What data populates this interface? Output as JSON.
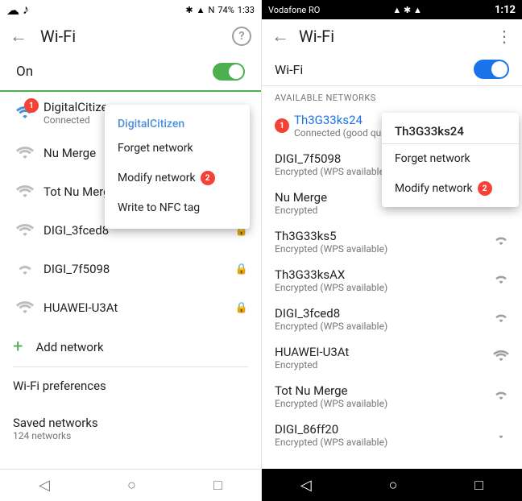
{
  "left": {
    "statusBar": {
      "leftIcons": "☁ 🎵",
      "bluetooth": "✦",
      "signal": "▲",
      "nfc": "N",
      "battery": "74%",
      "time": "1:33"
    },
    "toolbar": {
      "backLabel": "←",
      "title": "Wi-Fi",
      "helpLabel": "?"
    },
    "toggle": {
      "label": "On",
      "state": "on"
    },
    "networks": [
      {
        "name": "DigitalCitizen",
        "status": "Connected",
        "locked": false,
        "badge": "1",
        "connected": true
      },
      {
        "name": "Nu Merge",
        "status": "",
        "locked": true,
        "badge": "",
        "connected": false
      },
      {
        "name": "Tot Nu Merge",
        "status": "",
        "locked": true,
        "badge": "",
        "connected": false
      },
      {
        "name": "DIGI_3fced8",
        "status": "",
        "locked": true,
        "badge": "",
        "connected": false
      },
      {
        "name": "DIGI_7f5098",
        "status": "",
        "locked": true,
        "badge": "",
        "connected": false
      },
      {
        "name": "HUAWEI-U3At",
        "status": "",
        "locked": true,
        "badge": "",
        "connected": false
      }
    ],
    "addNetwork": "Add network",
    "wifiPreferences": "Wi-Fi preferences",
    "savedNetworks": {
      "label": "Saved networks",
      "sub": "124 networks"
    },
    "contextMenu": {
      "header": "DigitalCitizen",
      "items": [
        {
          "label": "Forget network",
          "badge": ""
        },
        {
          "label": "Modify network",
          "badge": "2"
        },
        {
          "label": "Write to NFC tag",
          "badge": ""
        }
      ]
    },
    "navBar": {
      "back": "◁",
      "home": "○",
      "recent": "□"
    }
  },
  "right": {
    "statusBar": {
      "carrier": "Vodafone RO",
      "icons": "▲▲✦▲",
      "battery": "■",
      "time": "1:12"
    },
    "toolbar": {
      "backLabel": "←",
      "title": "Wi-Fi",
      "moreLabel": "⋮"
    },
    "wifiToggle": {
      "label": "Wi-Fi"
    },
    "sectionHeader": "AVAILABLE NETWORKS",
    "networks": [
      {
        "name": "Th3G33ks24",
        "status": "Connected (good quality)",
        "highlight": true,
        "badge": "1"
      },
      {
        "name": "DIGI_7f5098",
        "status": "Encrypted (WPS available)",
        "highlight": false,
        "badge": ""
      },
      {
        "name": "Nu Merge",
        "status": "Encrypted",
        "highlight": false,
        "badge": ""
      },
      {
        "name": "Th3G33ks5",
        "status": "Encrypted (WPS available)",
        "highlight": false,
        "badge": ""
      },
      {
        "name": "Th3G33ksAX",
        "status": "Encrypted (WPS available)",
        "highlight": false,
        "badge": ""
      },
      {
        "name": "DIGI_3fced8",
        "status": "Encrypted (WPS available)",
        "highlight": false,
        "badge": ""
      },
      {
        "name": "HUAWEI-U3At",
        "status": "Encrypted",
        "highlight": false,
        "badge": ""
      },
      {
        "name": "Tot Nu Merge",
        "status": "Encrypted (WPS available)",
        "highlight": false,
        "badge": ""
      },
      {
        "name": "DIGI_86ff20",
        "status": "Encrypted (WPS available)",
        "highlight": false,
        "badge": ""
      }
    ],
    "contextMenu": {
      "header": "Th3G33ks24",
      "items": [
        {
          "label": "Forget network",
          "badge": ""
        },
        {
          "label": "Modify network",
          "badge": "2"
        }
      ]
    },
    "navBar": {
      "back": "◁",
      "home": "○",
      "recent": "□"
    }
  }
}
